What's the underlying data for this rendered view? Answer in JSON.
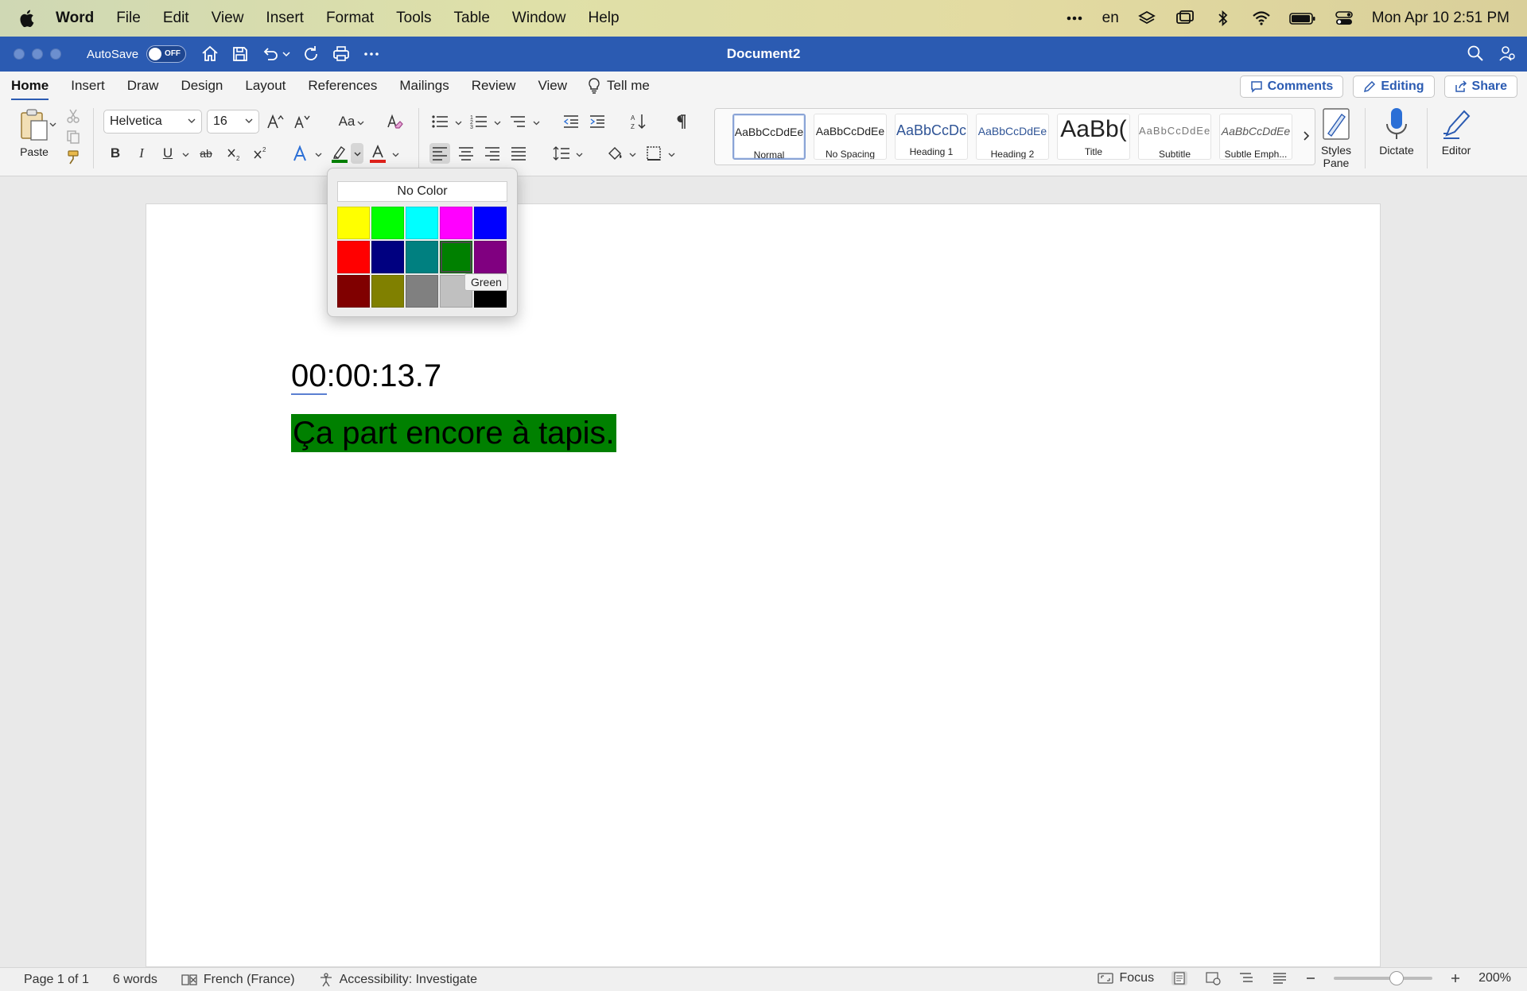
{
  "menubar": {
    "app_name": "Word",
    "items": [
      "File",
      "Edit",
      "View",
      "Insert",
      "Format",
      "Tools",
      "Table",
      "Window",
      "Help"
    ],
    "lang": "en",
    "datetime": "Mon Apr 10  2:51 PM"
  },
  "titlebar": {
    "autosave_label": "AutoSave",
    "autosave_state": "OFF",
    "document_title": "Document2"
  },
  "tabs": {
    "items": [
      "Home",
      "Insert",
      "Draw",
      "Design",
      "Layout",
      "References",
      "Mailings",
      "Review",
      "View"
    ],
    "active": "Home",
    "tell_me": "Tell me",
    "comments": "Comments",
    "editing": "Editing",
    "share": "Share"
  },
  "ribbon": {
    "paste_label": "Paste",
    "font_name": "Helvetica",
    "font_size": "16",
    "change_case": "Aa",
    "bold": "B",
    "italic": "I",
    "underline": "U",
    "strike": "ab",
    "styles": [
      {
        "sample": "AaBbCcDdEe",
        "name": "Normal"
      },
      {
        "sample": "AaBbCcDdEe",
        "name": "No Spacing"
      },
      {
        "sample": "AaBbCcDc",
        "name": "Heading 1"
      },
      {
        "sample": "AaBbCcDdEe",
        "name": "Heading 2"
      },
      {
        "sample": "AaBb(",
        "name": "Title"
      },
      {
        "sample": "AaBbCcDdEe",
        "name": "Subtitle"
      },
      {
        "sample": "AaBbCcDdEe",
        "name": "Subtle Emph..."
      }
    ],
    "styles_pane_1": "Styles",
    "styles_pane_2": "Pane",
    "dictate": "Dictate",
    "editor": "Editor"
  },
  "highlight_menu": {
    "no_color": "No Color",
    "swatches": [
      "#ffff00",
      "#00ff00",
      "#00ffff",
      "#ff00ff",
      "#0000ff",
      "#ff0000",
      "#000080",
      "#008080",
      "#008000",
      "#800080",
      "#800000",
      "#808000",
      "#808080",
      "#c0c0c0",
      "#000000"
    ],
    "hovered_index": 8,
    "tooltip": "Green"
  },
  "document": {
    "timecode": "00:00:13.7",
    "timecode_underlined": "00",
    "timecode_rest": ":00:13.7",
    "line": "Ça part encore à tapis.",
    "highlight_color": "#008000"
  },
  "statusbar": {
    "page": "Page 1 of 1",
    "words": "6 words",
    "language": "French (France)",
    "accessibility": "Accessibility: Investigate",
    "focus": "Focus",
    "zoom": "200%"
  },
  "colors": {
    "accent": "#2b5bb2",
    "title_bar": "#2b5bb2"
  }
}
